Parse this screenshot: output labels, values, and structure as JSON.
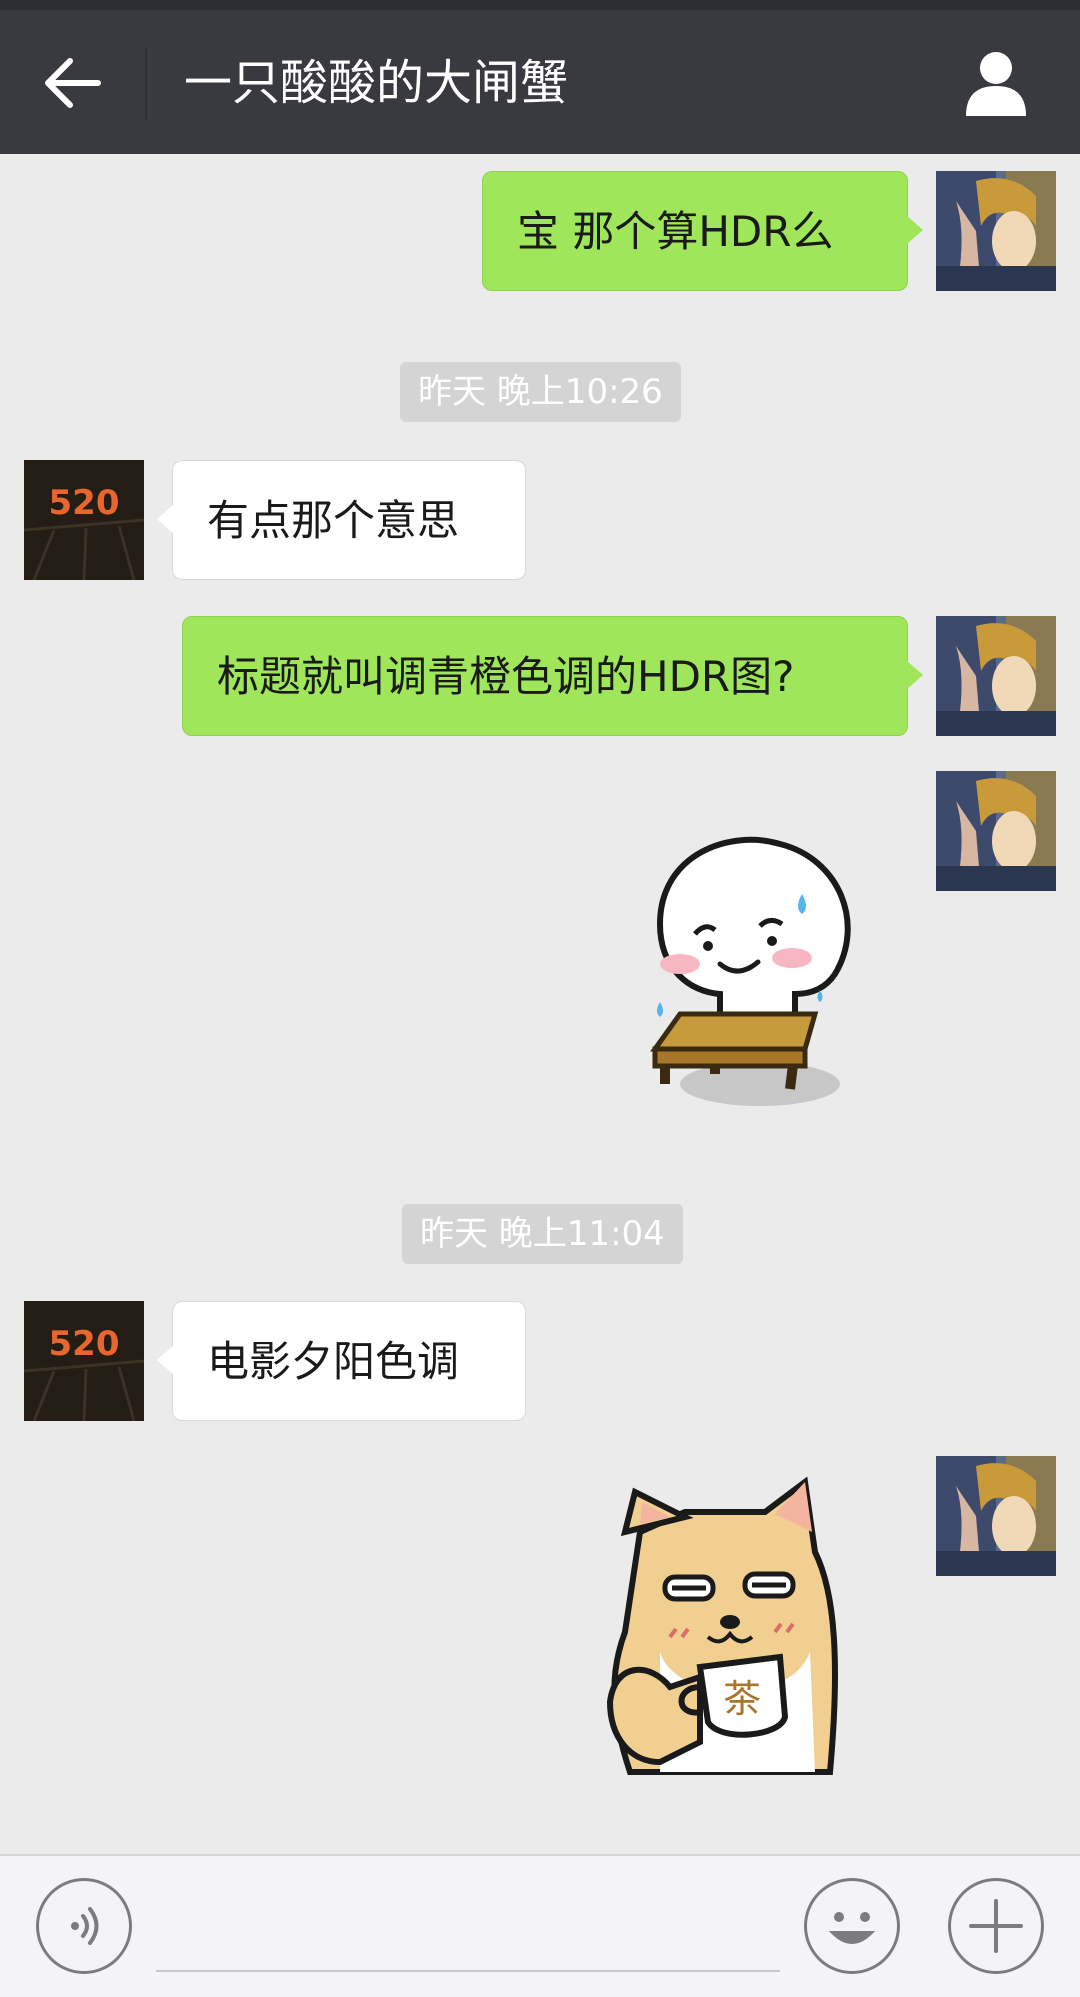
{
  "header": {
    "title": "一只酸酸的大闸蟹"
  },
  "messages": [
    {
      "id": "m1",
      "sender": "me",
      "type": "text",
      "text": "宝 那个算HDR么"
    },
    {
      "id": "t1",
      "type": "timestamp",
      "text": "昨天 晚上10:26"
    },
    {
      "id": "m2",
      "sender": "them",
      "type": "text",
      "text": "有点那个意思"
    },
    {
      "id": "m3",
      "sender": "me",
      "type": "text",
      "text": "标题就叫调青橙色调的HDR图?"
    },
    {
      "id": "m4",
      "sender": "me",
      "type": "sticker",
      "sticker": "sweating-bun-on-stool-sticker"
    },
    {
      "id": "t2",
      "type": "timestamp",
      "text": "昨天 晚上11:04"
    },
    {
      "id": "m5",
      "sender": "them",
      "type": "text",
      "text": "电影夕阳色调"
    },
    {
      "id": "m6",
      "sender": "me",
      "type": "sticker",
      "sticker": "shiba-dog-drinking-tea-sticker",
      "cup_text": "茶"
    }
  ],
  "avatars": {
    "them": {
      "text": "520",
      "color": "#e8662e"
    }
  },
  "inputbar": {
    "icons": [
      "voice-icon",
      "emoji-icon",
      "plus-icon"
    ]
  },
  "colors": {
    "header_bg": "#393a3f",
    "chat_bg": "#ebebeb",
    "my_bubble": "#9fe65a",
    "their_bubble": "#ffffff"
  }
}
